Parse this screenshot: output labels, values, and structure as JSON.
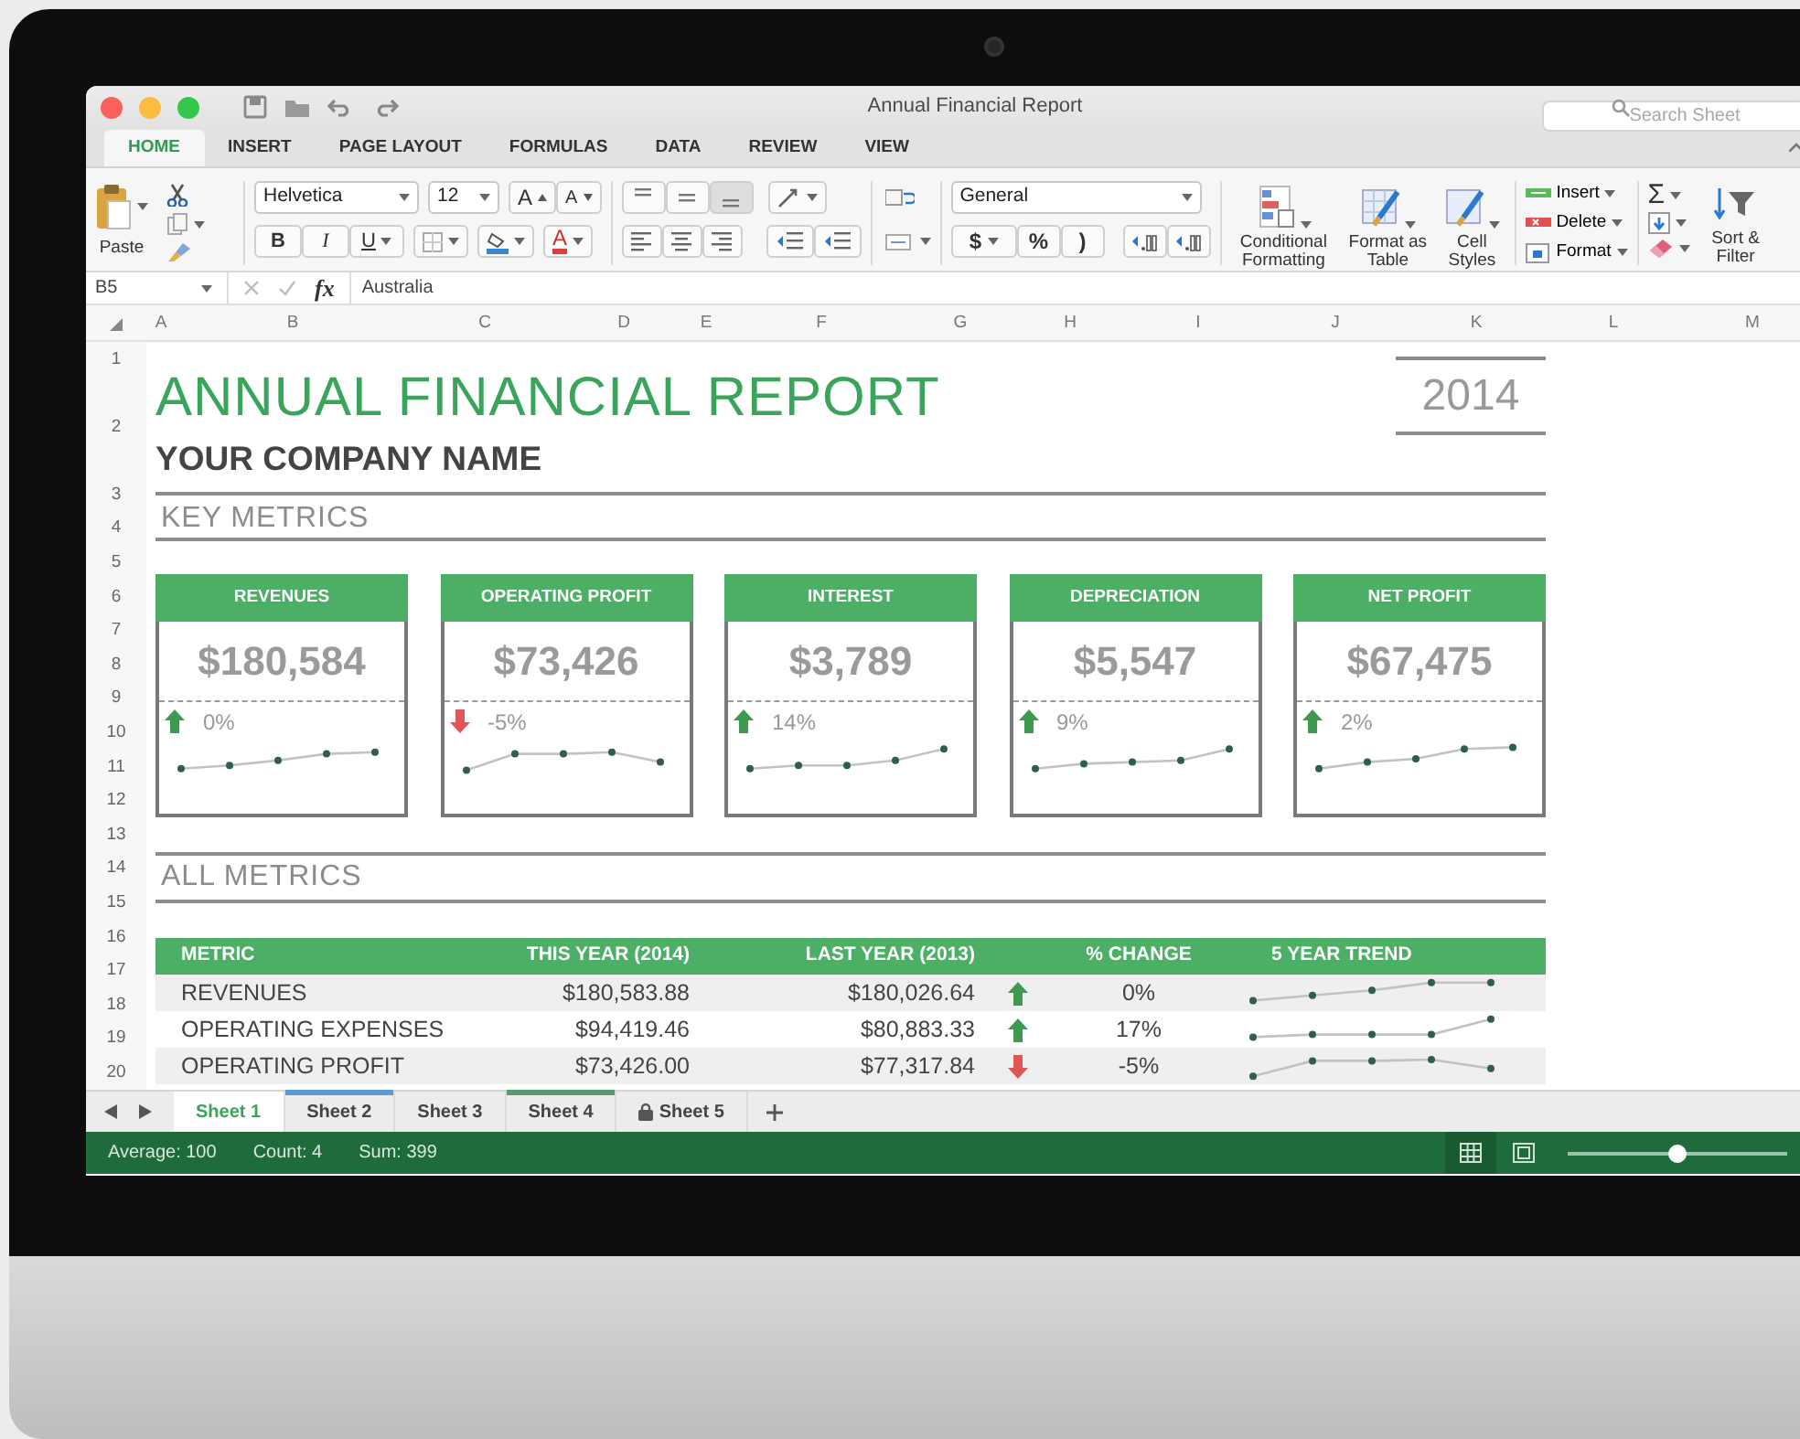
{
  "window": {
    "title": "Annual Financial Report"
  },
  "search": {
    "placeholder": "Search Sheet"
  },
  "ribbon_tabs": [
    {
      "label": "HOME",
      "selected": true
    },
    {
      "label": "INSERT",
      "selected": false
    },
    {
      "label": "PAGE LAYOUT",
      "selected": false
    },
    {
      "label": "FORMULAS",
      "selected": false
    },
    {
      "label": "DATA",
      "selected": false
    },
    {
      "label": "REVIEW",
      "selected": false
    },
    {
      "label": "VIEW",
      "selected": false
    }
  ],
  "ribbon": {
    "paste_label": "Paste",
    "font": "Helvetica",
    "font_size": "12",
    "grow_font": "A",
    "shrink_font": "A",
    "style_buttons": [
      "B",
      "I",
      "U"
    ],
    "font_color": "A",
    "number_format": "General",
    "number_buttons": [
      "$",
      "%",
      ")"
    ],
    "style_commands": [
      "Conditional Formatting",
      "Format as Table",
      "Cell Styles"
    ],
    "cell_commands": [
      "Insert",
      "Delete",
      "Format"
    ],
    "sum": "Σ",
    "sort_label": "Sort & Filter"
  },
  "formula_bar": {
    "cell": "B5",
    "fx": "fx",
    "value": "Australia"
  },
  "columns": [
    "A",
    "B",
    "C",
    "D",
    "E",
    "F",
    "G",
    "H",
    "I",
    "J",
    "K",
    "L",
    "M"
  ],
  "rows": [
    "1",
    "2",
    "3",
    "4",
    "5",
    "6",
    "7",
    "8",
    "9",
    "10",
    "11",
    "12",
    "13",
    "14",
    "15",
    "16",
    "17",
    "18",
    "19",
    "20"
  ],
  "sheet": {
    "title": "ANNUAL FINANCIAL REPORT",
    "year": "2014",
    "company": "YOUR COMPANY NAME",
    "key_metrics_heading": "KEY METRICS",
    "metrics": [
      {
        "title": "REVENUES",
        "value": "$180,584",
        "increase": true,
        "change": "0%"
      },
      {
        "title": "OPERATING PROFIT",
        "value": "$73,426",
        "increase": false,
        "change": "-5%"
      },
      {
        "title": "INTEREST",
        "value": "$3,789",
        "increase": true,
        "change": "14%"
      },
      {
        "title": "DEPRECIATION",
        "value": "$5,547",
        "increase": true,
        "change": "9%"
      },
      {
        "title": "NET PROFIT",
        "value": "$67,475",
        "increase": true,
        "change": "2%"
      }
    ],
    "all_metrics_heading": "ALL METRICS",
    "table": {
      "columns": [
        "METRIC",
        "THIS YEAR (2014)",
        "LAST YEAR (2013)",
        "% CHANGE",
        "5 YEAR TREND"
      ],
      "rows": [
        {
          "metric": "REVENUES",
          "this_year": "$180,583.88",
          "last_year": "$180,026.64",
          "increase": true,
          "change": "0%"
        },
        {
          "metric": "OPERATING EXPENSES",
          "this_year": "$94,419.46",
          "last_year": "$80,883.33",
          "increase": true,
          "change": "17%"
        },
        {
          "metric": "OPERATING PROFIT",
          "this_year": "$73,426.00",
          "last_year": "$77,317.84",
          "increase": false,
          "change": "-5%"
        }
      ]
    }
  },
  "sheet_tabs": [
    {
      "label": "Sheet 1",
      "selected": true
    },
    {
      "label": "Sheet 2",
      "selected": false,
      "color": "#5b9bd5"
    },
    {
      "label": "Sheet 3",
      "selected": false
    },
    {
      "label": "Sheet 4",
      "selected": false,
      "color": "#5a9a72"
    },
    {
      "label": "Sheet 5",
      "selected": false,
      "locked": true
    }
  ],
  "status_bar": {
    "items": [
      "Average: 100",
      "Count: 4",
      "Sum: 399"
    ],
    "zoom": {
      "level": 0.5
    }
  }
}
